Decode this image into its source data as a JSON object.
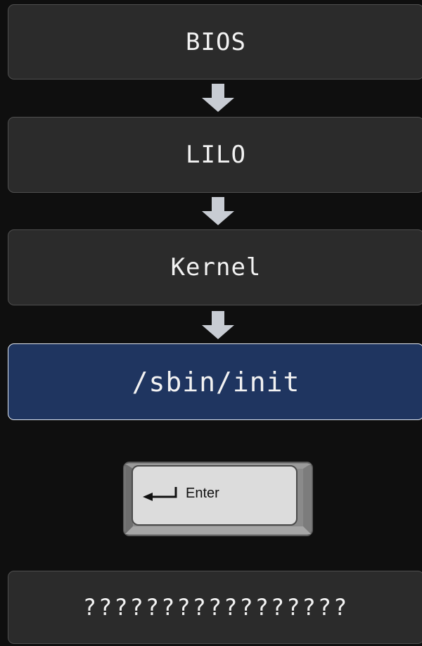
{
  "stages": [
    {
      "label": "BIOS"
    },
    {
      "label": "LILO"
    },
    {
      "label": "Kernel"
    },
    {
      "label": "/sbin/init"
    }
  ],
  "enter_key": {
    "label": "Enter",
    "icon": "return-arrow-icon"
  },
  "result": {
    "label": "?????????????????"
  },
  "colors": {
    "background": "#0f0f0f",
    "stage_fill": "#2b2b2b",
    "active_fill": "#1f3560",
    "arrow": "#c8ccd3",
    "key_face": "#dcdcdc",
    "key_rim": "#8a8a8a"
  }
}
